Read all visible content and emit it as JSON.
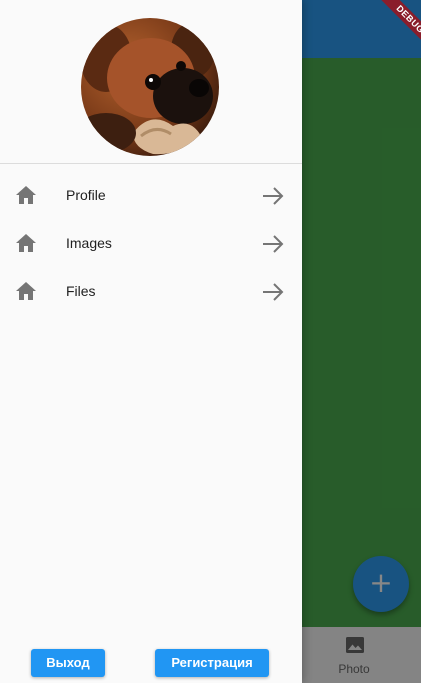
{
  "debug_banner": "DEBUG",
  "colors": {
    "primary": "#2196f3",
    "app_bar": "#2f9df4",
    "app_body": "#4caf50",
    "drawer_bg": "#fafafa",
    "debug_banner": "#8a1d2b"
  },
  "drawer": {
    "avatar_icon": "puppy-photo",
    "menu": [
      {
        "label": "Profile",
        "icon": "home-icon",
        "trailing": "arrow-forward-icon"
      },
      {
        "label": "Images",
        "icon": "home-icon",
        "trailing": "arrow-forward-icon"
      },
      {
        "label": "Files",
        "icon": "home-icon",
        "trailing": "arrow-forward-icon"
      }
    ],
    "buttons": {
      "exit": "Выход",
      "register": "Регистрация"
    }
  },
  "background_app": {
    "fab_icon": "plus-icon",
    "fab_symbol": "+",
    "bottom_nav": {
      "label": "Photo",
      "icon": "photo-icon"
    }
  }
}
